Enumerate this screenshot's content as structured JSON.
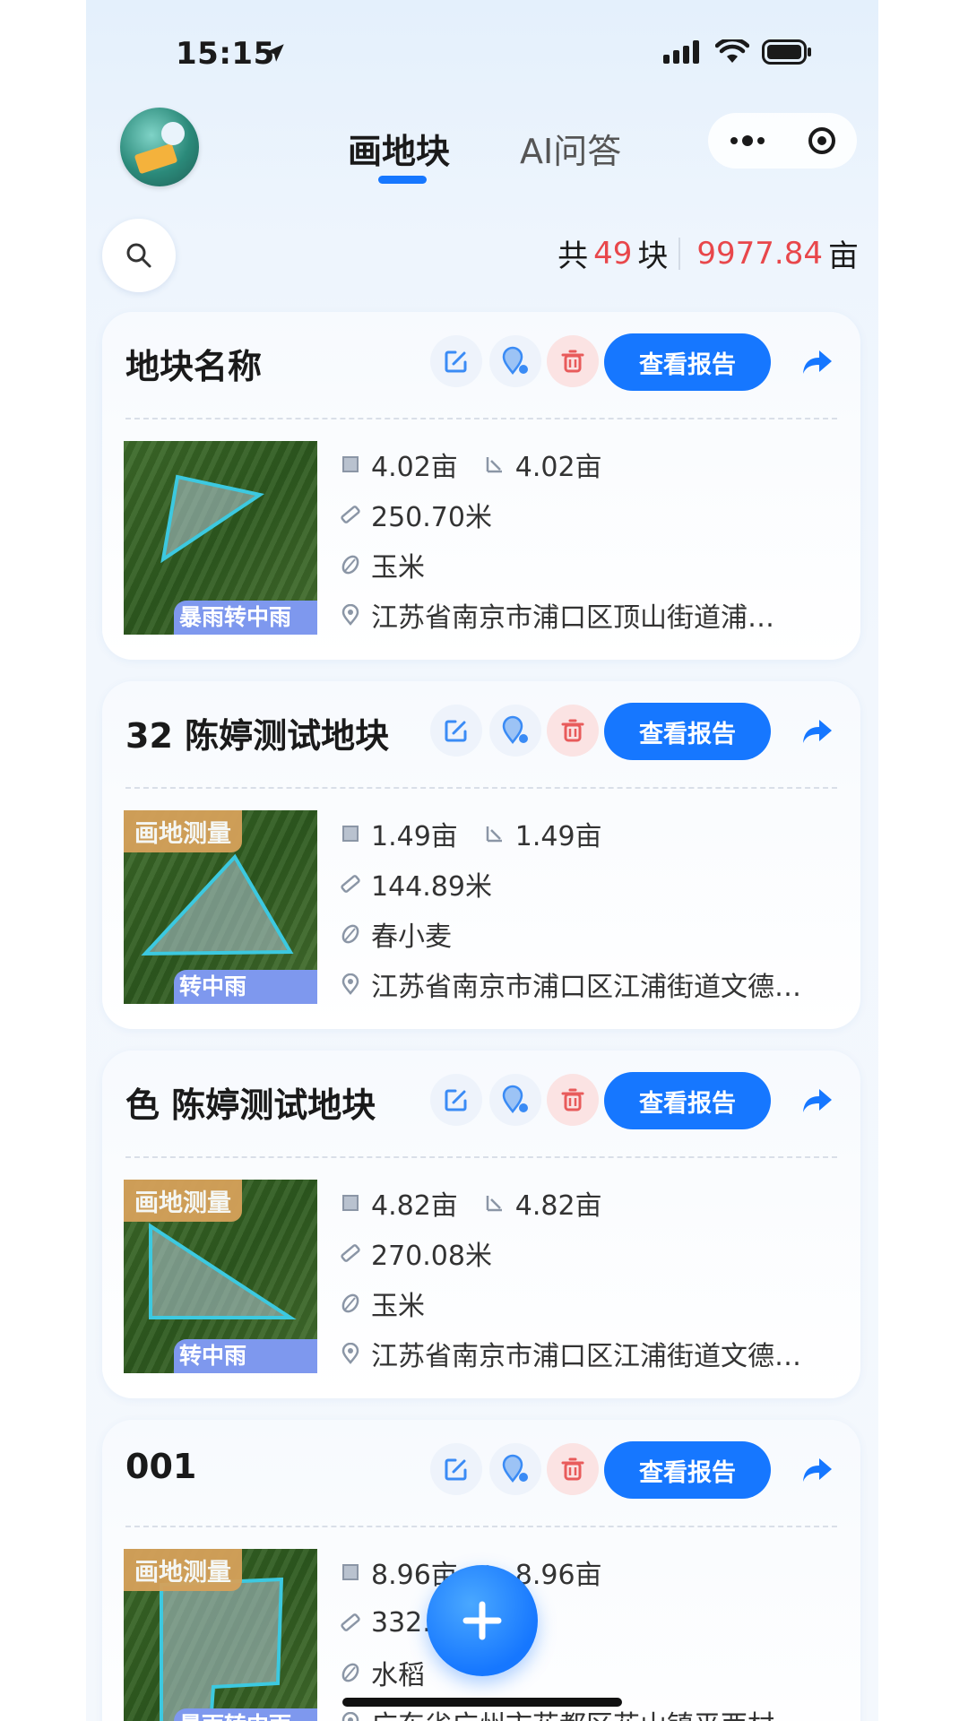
{
  "status_bar": {
    "time": "15:15"
  },
  "header": {
    "tabs": [
      {
        "label": "画地块",
        "active": true
      },
      {
        "label": "AI问答",
        "active": false
      }
    ]
  },
  "summary": {
    "prefix": "共",
    "count": "49",
    "unit_count": "块",
    "area": "9977.84",
    "unit_area": "亩"
  },
  "cards": [
    {
      "title": "地块名称",
      "badge": "",
      "weather": "暴雨转中雨",
      "area1": "4.02亩",
      "area2": "4.02亩",
      "perimeter": "250.70米",
      "crop": "玉米",
      "address": "江苏省南京市浦口区顶山街道浦…",
      "report_label": "查看报告"
    },
    {
      "title": "32  陈婷测试地块",
      "badge": "画地测量",
      "weather": "转中雨",
      "area1": "1.49亩",
      "area2": "1.49亩",
      "perimeter": "144.89米",
      "crop": "春小麦",
      "address": "江苏省南京市浦口区江浦街道文德…",
      "report_label": "查看报告"
    },
    {
      "title": "色  陈婷测试地块",
      "badge": "画地测量",
      "weather": "转中雨",
      "area1": "4.82亩",
      "area2": "4.82亩",
      "perimeter": "270.08米",
      "crop": "玉米",
      "address": "江苏省南京市浦口区江浦街道文德…",
      "report_label": "查看报告"
    },
    {
      "title": "001",
      "badge": "画地测量",
      "weather": "暴雨转中雨",
      "area1": "8.96亩",
      "area2": "8.96亩",
      "perimeter": "332.",
      "crop": "水稻",
      "address": "广东省广州市花都区花山镇平西村",
      "report_label": "查看报告"
    }
  ],
  "colors": {
    "accent": "#1677ff",
    "highlight": "#e8474b",
    "delete": "#e85b5b",
    "badge": "#d6a15a",
    "plot_outline": "#3cc9e0"
  }
}
